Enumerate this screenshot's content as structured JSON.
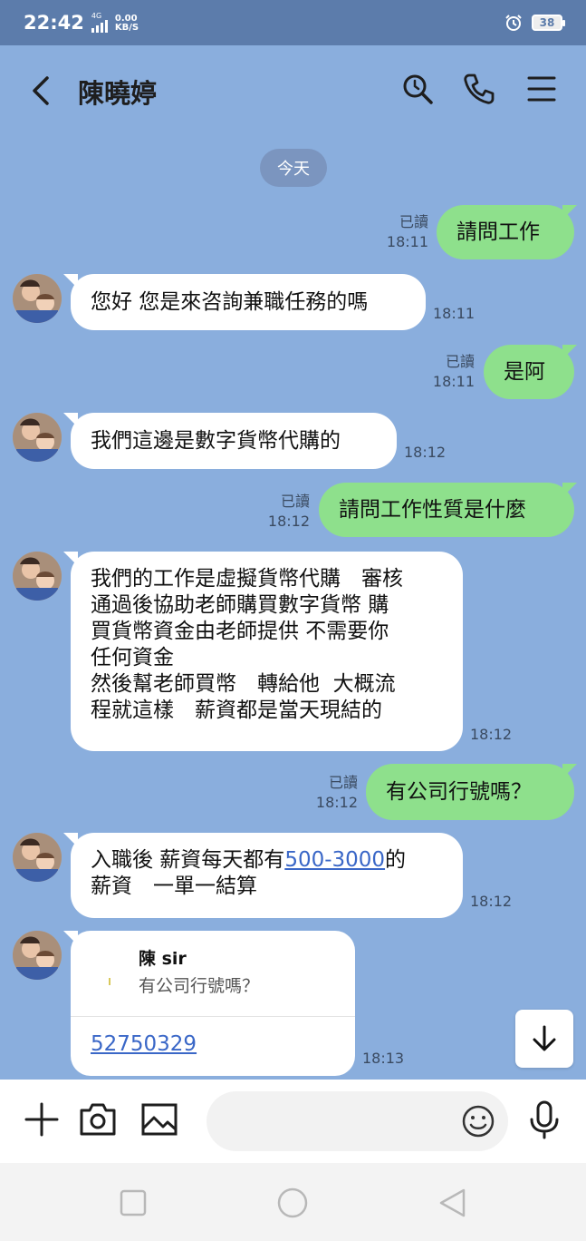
{
  "status_bar": {
    "time": "22:42",
    "network_type": "4G",
    "speed_value": "0.00",
    "speed_unit": "KB/S",
    "battery": "38"
  },
  "header": {
    "title": "陳曉婷"
  },
  "date_divider": "今天",
  "read_label": "已讀",
  "messages": [
    {
      "direction": "out",
      "text": "請問工作",
      "read": "已讀",
      "time": "18:11"
    },
    {
      "direction": "in",
      "text": "您好 您是來咨詢兼職任務的嗎",
      "time": "18:11"
    },
    {
      "direction": "out",
      "text": "是阿",
      "read": "已讀",
      "time": "18:11"
    },
    {
      "direction": "in",
      "text": "我們這邊是數字貨幣代購的",
      "time": "18:12"
    },
    {
      "direction": "out",
      "text": "請問工作性質是什麼",
      "read": "已讀",
      "time": "18:12"
    },
    {
      "direction": "in",
      "lines": [
        "我們的工作是虛擬貨幣代購　審核",
        "通過後協助老師購買數字貨幣 購",
        "買貨幣資金由老師提供 不需要你",
        "任何資金",
        "然後幫老師買幣　轉給他  大概流",
        "程就這樣　薪資都是當天現結的"
      ],
      "time": "18:12"
    },
    {
      "direction": "out",
      "text": "有公司行號嗎？",
      "read": "已讀",
      "time": "18:12"
    },
    {
      "direction": "in",
      "line1_before": "入職後 薪資每天都有",
      "line1_link": "500-3000",
      "line1_after": "的",
      "line2": "薪資　一單一結算",
      "time": "18:12"
    },
    {
      "direction": "in",
      "type": "reply",
      "reply_to_sender": "陳 sir",
      "reply_to_text": "有公司行號嗎？",
      "text": "52750329",
      "time": "18:13"
    }
  ],
  "input": {
    "placeholder": ""
  },
  "colors": {
    "chat_background": "#8aaedd",
    "status_bar": "#5c7cab",
    "outgoing_bubble": "#8ee08c",
    "incoming_bubble": "#ffffff",
    "link": "#3a67c7"
  },
  "icons": [
    "back-arrow-icon",
    "search-icon",
    "phone-icon",
    "menu-icon",
    "plus-icon",
    "camera-icon",
    "image-icon",
    "emoji-icon",
    "microphone-icon",
    "arrow-down-icon",
    "alarm-icon"
  ]
}
